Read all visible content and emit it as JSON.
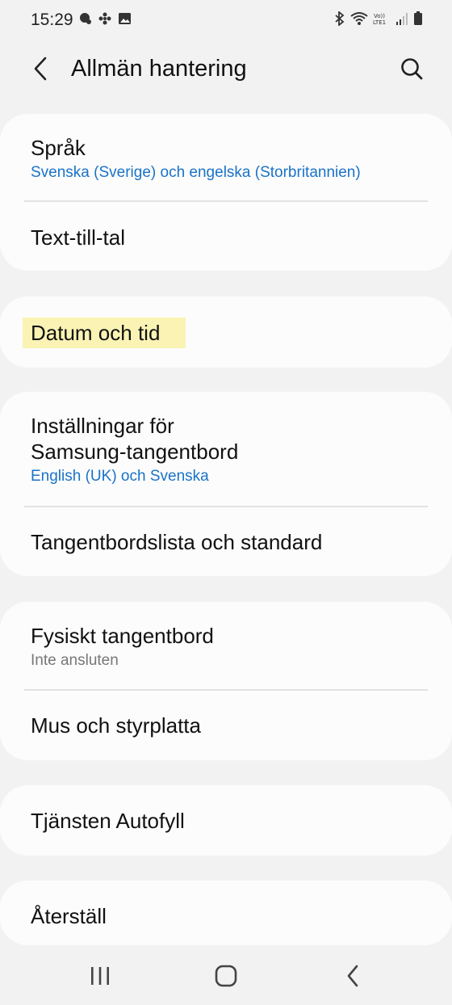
{
  "status": {
    "time": "15:29"
  },
  "appbar": {
    "title": "Allmän hantering"
  },
  "cards": [
    {
      "items": [
        {
          "title": "Språk",
          "subtitle": "Svenska (Sverige) och engelska (Storbritannien)"
        },
        {
          "title": "Text-till-tal"
        }
      ]
    },
    {
      "items": [
        {
          "title": "Datum och tid"
        }
      ]
    },
    {
      "items": [
        {
          "title_line1": "Inställningar för",
          "title_line2": "Samsung-tangentbord",
          "subtitle": "English (UK) och Svenska"
        },
        {
          "title": "Tangentbordslista och standard"
        }
      ]
    },
    {
      "items": [
        {
          "title": "Fysiskt tangentbord",
          "subtitle": "Inte ansluten"
        },
        {
          "title": "Mus och styrplatta"
        }
      ]
    },
    {
      "items": [
        {
          "title": "Tjänsten Autofyll"
        }
      ]
    },
    {
      "items": [
        {
          "title": "Återställ"
        }
      ]
    }
  ],
  "icons": {
    "back": "chevron-left-icon",
    "search": "search-icon",
    "nav_recents": "recents-icon",
    "nav_home": "home-icon",
    "nav_back": "back-icon"
  },
  "colors": {
    "background": "#f2f2f2",
    "card": "#fcfcfc",
    "link_blue": "#1a73c7",
    "highlight": "#faf3b3"
  }
}
